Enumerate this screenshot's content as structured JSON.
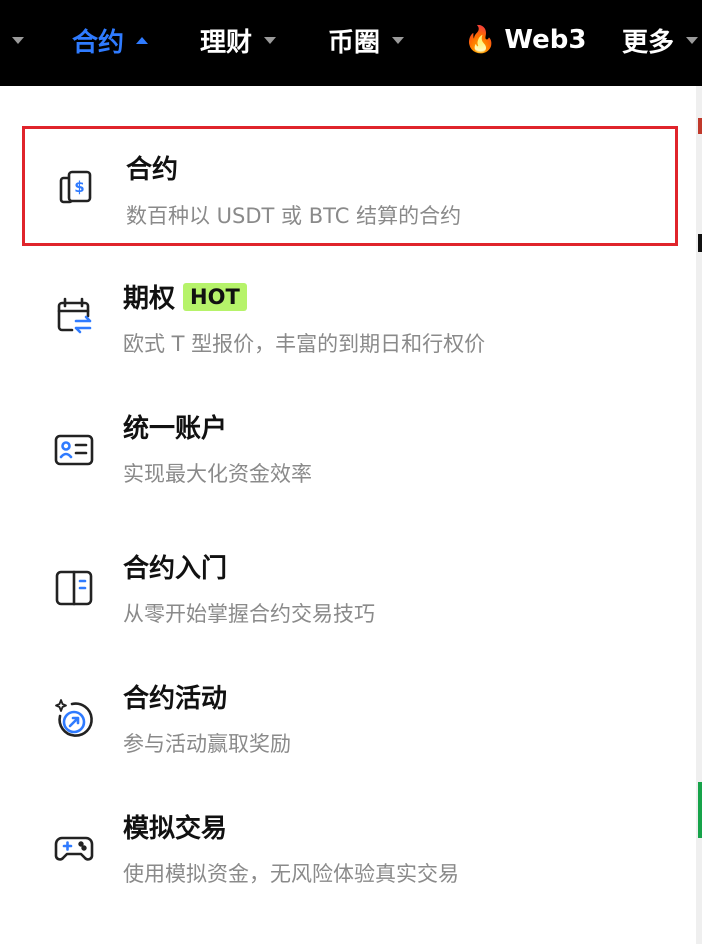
{
  "nav": {
    "items": [
      {
        "label": "合约",
        "active": true
      },
      {
        "label": "理财"
      },
      {
        "label": "币圈"
      },
      {
        "label": "Web3",
        "icon": "flame-icon"
      },
      {
        "label": "更多"
      }
    ]
  },
  "menu": {
    "items": [
      {
        "title": "合约",
        "desc": "数百种以 USDT 或 BTC 结算的合约",
        "icon": "contract-icon",
        "selected": true
      },
      {
        "title": "期权",
        "badge": "HOT",
        "desc": "欧式 T 型报价，丰富的到期日和行权价",
        "icon": "calendar-exchange-icon"
      },
      {
        "title": "统一账户",
        "desc": "实现最大化资金效率",
        "icon": "id-card-icon"
      },
      {
        "title": "合约入门",
        "desc": "从零开始掌握合约交易技巧",
        "icon": "book-icon"
      },
      {
        "title": "合约活动",
        "desc": "参与活动赢取奖励",
        "icon": "sparkle-circle-icon"
      },
      {
        "title": "模拟交易",
        "desc": "使用模拟资金，无风险体验真实交易",
        "icon": "gamepad-icon"
      }
    ]
  },
  "colors": {
    "nav_bg": "#000000",
    "active": "#2f7bff",
    "selected_border": "#e0242b",
    "badge_bg": "#b6f36a",
    "icon_accent": "#2f7bff"
  }
}
